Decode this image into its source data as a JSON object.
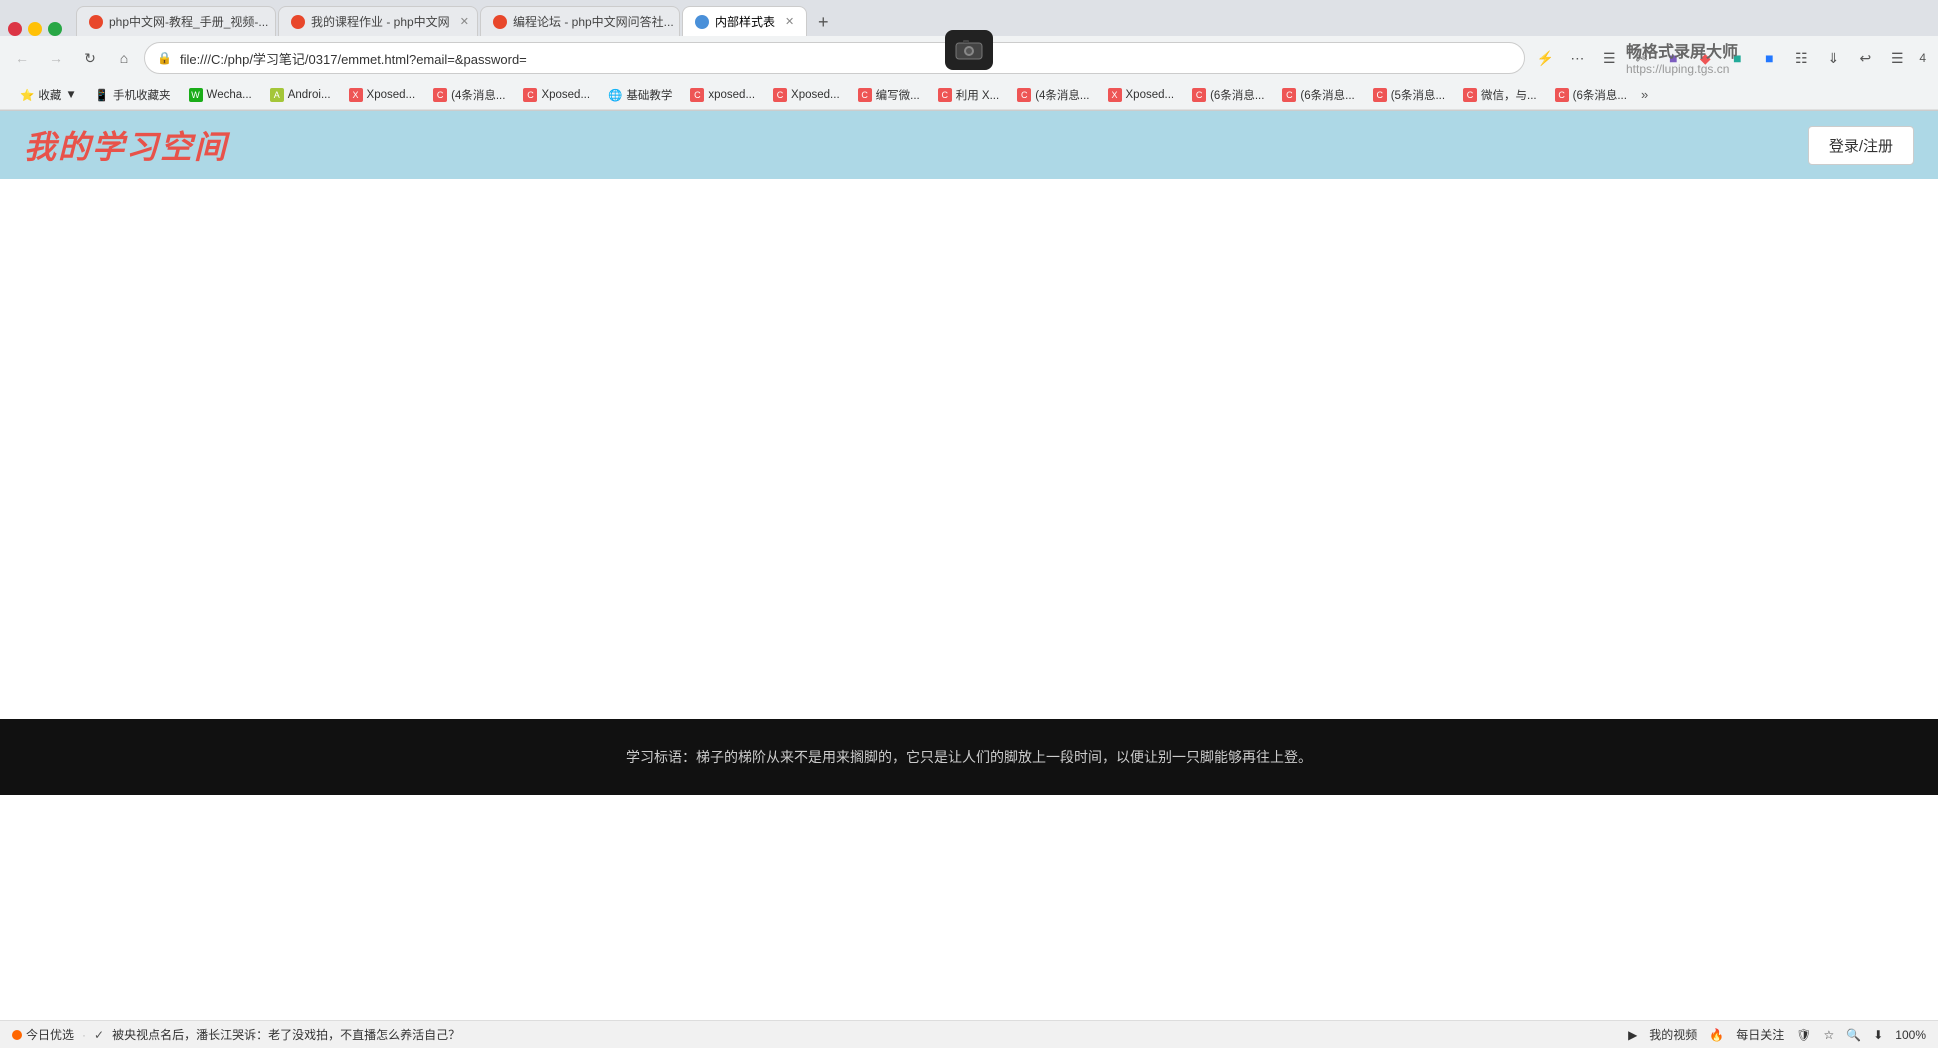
{
  "browser": {
    "tabs": [
      {
        "id": 1,
        "label": "php中文网-教程_手册_视频-...",
        "active": false,
        "color": "#e8472b"
      },
      {
        "id": 2,
        "label": "我的课程作业 - php中文网",
        "active": false,
        "color": "#e8472b"
      },
      {
        "id": 3,
        "label": "编程论坛 - php中文网问答社...",
        "active": false,
        "color": "#e8472b"
      },
      {
        "id": 4,
        "label": "内部样式表",
        "active": true,
        "color": "#4a90d9"
      }
    ],
    "address": "file:///C:/php/学习笔记/0317/emmet.html?email=&password=",
    "address_display": "file:///C:/php/学习笔记/0317/emmet.html?email=&password=",
    "window_num": "4"
  },
  "bookmarks": [
    {
      "label": "收藏",
      "icon": "⭐"
    },
    {
      "label": "手机收藏夹",
      "icon": "📱"
    },
    {
      "label": "Wecha...",
      "icon": "🐱"
    },
    {
      "label": "Androi...",
      "icon": "🤖"
    },
    {
      "label": "Xposed...",
      "icon": "X",
      "color": "#e55"
    },
    {
      "label": "(4条消息...",
      "icon": "C",
      "color": "#e55"
    },
    {
      "label": "Xposed...",
      "icon": "C",
      "color": "#e55"
    },
    {
      "label": "基础教学",
      "icon": "🌐"
    },
    {
      "label": "xposed...",
      "icon": "C",
      "color": "#e55"
    },
    {
      "label": "Xposed...",
      "icon": "C",
      "color": "#e55"
    },
    {
      "label": "编写微...",
      "icon": "C",
      "color": "#e55"
    },
    {
      "label": "利用 X...",
      "icon": "C",
      "color": "#e55"
    },
    {
      "label": "(4条消息...",
      "icon": "C",
      "color": "#e55"
    },
    {
      "label": "Xposed...",
      "icon": "X",
      "color": "#e55"
    },
    {
      "label": "(6条消息...",
      "icon": "C",
      "color": "#e55"
    },
    {
      "label": "(6条消息...",
      "icon": "C",
      "color": "#e55"
    },
    {
      "label": "(5条消息...",
      "icon": "C",
      "color": "#e55"
    },
    {
      "label": "微信，与...",
      "icon": "C",
      "color": "#e55"
    },
    {
      "label": "(6条消息...",
      "icon": "C",
      "color": "#e55"
    }
  ],
  "page": {
    "header": {
      "title": "我的学习空间",
      "login_button": "登录/注册"
    },
    "footer": {
      "motto": "学习标语：梯子的梯阶从来不是用来搁脚的，它只是让人们的脚放上一段时间，以便让别一只脚能够再往上登。"
    }
  },
  "status_bar": {
    "today_pick": "今日优选",
    "news_text": "被央视点名后，潘长江哭诉：老了没戏拍，不直播怎么养活自己？",
    "my_video": "我的视频",
    "daily_follow": "每日关注",
    "zoom": "100%"
  },
  "watermark": {
    "brand": "畅格式录屏大师",
    "url": "https://luping.tgs.cn"
  }
}
